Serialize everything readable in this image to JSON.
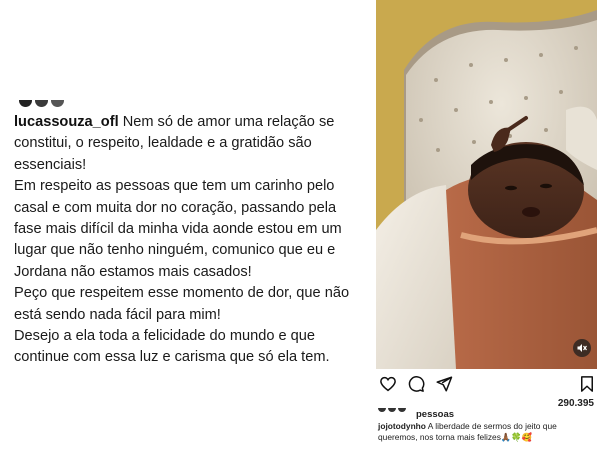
{
  "caption_post": {
    "username": "lucassouza_ofl",
    "lines": [
      "Nem só de amor uma relação se constitui, o respeito, lealdade e a gratidão são essenciais!",
      "Em respeito as pessoas que tem um carinho pelo casal e com muita dor no coração, passando pela fase mais difícil da minha vida aonde estou em um lugar que não tenho ninguém, comunico que eu e Jordana não estamos mais casados!",
      "Peço que respeitem esse momento de dor, que não está sendo nada fácil para mim!",
      "Desejo a ela toda a felicidade do mundo e que continue com essa luz e carisma que só ela tem."
    ]
  },
  "instagram_post": {
    "likes_count": "290.395",
    "liked_by_label": "pessoas",
    "caption_username": "jojotodynho",
    "caption_text": "A liberdade de sermos do jeito que queremos, nos torna mais felizes🙏🏾🍀🥰",
    "icons": {
      "like": "heart-icon",
      "comment": "comment-icon",
      "share": "send-icon",
      "save": "bookmark-icon",
      "mute": "muted-speaker-icon"
    }
  }
}
